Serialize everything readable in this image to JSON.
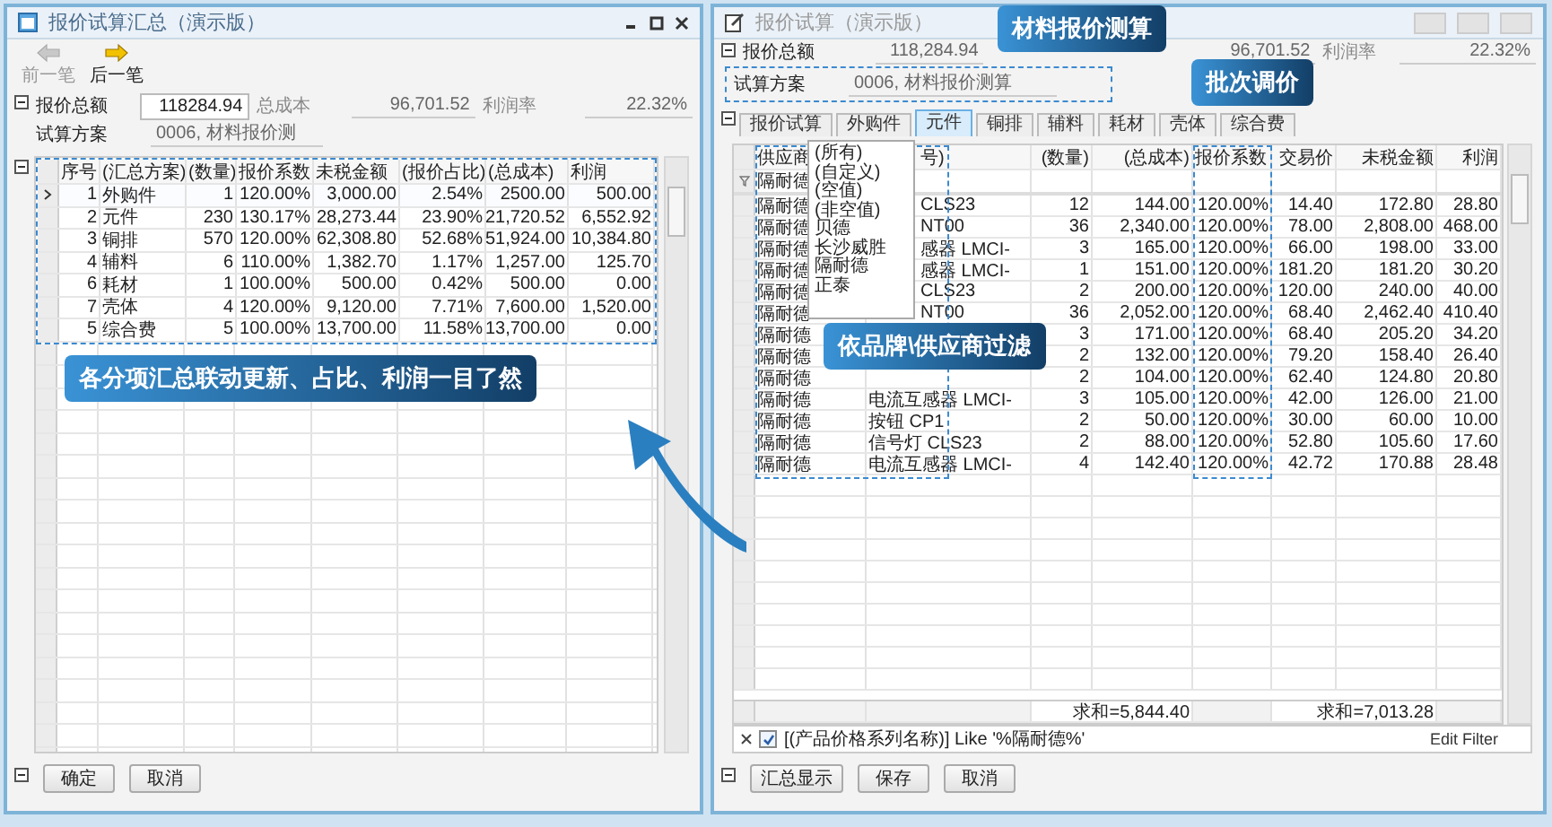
{
  "left_window": {
    "title": "报价试算汇总（演示版）",
    "nav": [
      {
        "label": "前一笔",
        "disabled": true
      },
      {
        "label": "后一笔",
        "disabled": false
      }
    ],
    "total_label": "报价总额",
    "total_value": "118284.94",
    "cost_label": "总成本",
    "cost_value": "96,701.52",
    "rate_label": "利润率",
    "rate_value": "22.32%",
    "plan_label": "试算方案",
    "plan_value": "0006, 材料报价测",
    "table": {
      "columns": [
        "序号",
        "(汇总方案)",
        "(数量)",
        "报价系数",
        "未税金额",
        "(报价占比)",
        "(总成本)",
        "利润"
      ],
      "rows": [
        {
          "selected": true,
          "cells": [
            "1",
            "外购件",
            "1",
            "120.00%",
            "3,000.00",
            "2.54%",
            "2500.00",
            "500.00"
          ]
        },
        {
          "selected": false,
          "cells": [
            "2",
            "元件",
            "230",
            "130.17%",
            "28,273.44",
            "23.90%",
            "21,720.52",
            "6,552.92"
          ]
        },
        {
          "selected": false,
          "cells": [
            "3",
            "铜排",
            "570",
            "120.00%",
            "62,308.80",
            "52.68%",
            "51,924.00",
            "10,384.80"
          ]
        },
        {
          "selected": false,
          "cells": [
            "4",
            "辅料",
            "6",
            "110.00%",
            "1,382.70",
            "1.17%",
            "1,257.00",
            "125.70"
          ]
        },
        {
          "selected": false,
          "cells": [
            "6",
            "耗材",
            "1",
            "100.00%",
            "500.00",
            "0.42%",
            "500.00",
            "0.00"
          ]
        },
        {
          "selected": false,
          "cells": [
            "7",
            "壳体",
            "4",
            "120.00%",
            "9,120.00",
            "7.71%",
            "7,600.00",
            "1,520.00"
          ]
        },
        {
          "selected": false,
          "cells": [
            "5",
            "综合费",
            "5",
            "100.00%",
            "13,700.00",
            "11.58%",
            "13,700.00",
            "0.00"
          ]
        }
      ]
    },
    "buttons": [
      "确定",
      "取消"
    ]
  },
  "right_window": {
    "title": "报价试算（演示版）",
    "total_label": "报价总额",
    "total_value": "118,284.94",
    "cost_value": "96,701.52",
    "rate_label": "利润率",
    "rate_value": "22.32%",
    "plan_label": "试算方案",
    "plan_value": "0006, 材料报价测算",
    "tabs": [
      {
        "label": "报价试算",
        "selected": false
      },
      {
        "label": "外购件",
        "selected": false
      },
      {
        "label": "元件",
        "selected": true
      },
      {
        "label": "铜排",
        "selected": false
      },
      {
        "label": "辅料",
        "selected": false
      },
      {
        "label": "耗材",
        "selected": false
      },
      {
        "label": "壳体",
        "selected": false
      },
      {
        "label": "综合费",
        "selected": false
      }
    ],
    "table": {
      "columns": [
        "供应商",
        "号)",
        "(数量)",
        "(总成本)",
        "报价系数",
        "交易价",
        "未税金额",
        "利润"
      ],
      "filter_value": "隔耐德",
      "rows": [
        {
          "cells": [
            "隔耐德",
            "CLS23",
            "12",
            "144.00",
            "120.00%",
            "14.40",
            "172.80",
            "28.80"
          ]
        },
        {
          "cells": [
            "隔耐德",
            "NT00",
            "36",
            "2,340.00",
            "120.00%",
            "78.00",
            "2,808.00",
            "468.00"
          ]
        },
        {
          "cells": [
            "隔耐德",
            "感器 LMCI-",
            "3",
            "165.00",
            "120.00%",
            "66.00",
            "198.00",
            "33.00"
          ]
        },
        {
          "cells": [
            "隔耐德",
            "感器 LMCI-",
            "1",
            "151.00",
            "120.00%",
            "181.20",
            "181.20",
            "30.20"
          ]
        },
        {
          "cells": [
            "隔耐德",
            "CLS23",
            "2",
            "200.00",
            "120.00%",
            "120.00",
            "240.00",
            "40.00"
          ]
        },
        {
          "cells": [
            "隔耐德",
            "NT00",
            "36",
            "2,052.00",
            "120.00%",
            "68.40",
            "2,462.40",
            "410.40"
          ]
        },
        {
          "cells": [
            "隔耐德",
            "",
            "3",
            "171.00",
            "120.00%",
            "68.40",
            "205.20",
            "34.20"
          ]
        },
        {
          "cells": [
            "隔耐德",
            "",
            "2",
            "132.00",
            "120.00%",
            "79.20",
            "158.40",
            "26.40"
          ]
        },
        {
          "cells": [
            "隔耐德",
            "",
            "2",
            "104.00",
            "120.00%",
            "62.40",
            "124.80",
            "20.80"
          ]
        },
        {
          "cells": [
            "隔耐德",
            "电流互感器 LMCI-",
            "3",
            "105.00",
            "120.00%",
            "42.00",
            "126.00",
            "21.00"
          ]
        },
        {
          "cells": [
            "隔耐德",
            "按钮 CP1",
            "2",
            "50.00",
            "120.00%",
            "30.00",
            "60.00",
            "10.00"
          ]
        },
        {
          "cells": [
            "隔耐德",
            "信号灯 CLS23",
            "2",
            "88.00",
            "120.00%",
            "52.80",
            "105.60",
            "17.60"
          ]
        },
        {
          "cells": [
            "隔耐德",
            "电流互感器 LMCI-",
            "4",
            "142.40",
            "120.00%",
            "42.72",
            "170.88",
            "28.48"
          ]
        }
      ],
      "totals": {
        "cost_sum": "求和=5,844.40",
        "untaxed_sum": "求和=7,013.28"
      }
    },
    "filter": {
      "checked": true,
      "text": "[(产品价格系列名称)] Like '%隔耐德%'",
      "edit_label": "Edit Filter"
    },
    "dropdown": {
      "items": [
        "(所有)",
        "(自定义)",
        "(空值)",
        "(非空值)",
        "贝德",
        "长沙威胜",
        "隔耐德",
        "正泰"
      ]
    },
    "buttons": [
      "汇总显示",
      "保存",
      "取消"
    ]
  },
  "callouts": [
    {
      "text": "材料报价测算"
    },
    {
      "text": "批次调价"
    },
    {
      "text": "依品牌\\供应商过滤"
    },
    {
      "text": "各分项汇总联动更新、占比、利润一目了然"
    }
  ]
}
